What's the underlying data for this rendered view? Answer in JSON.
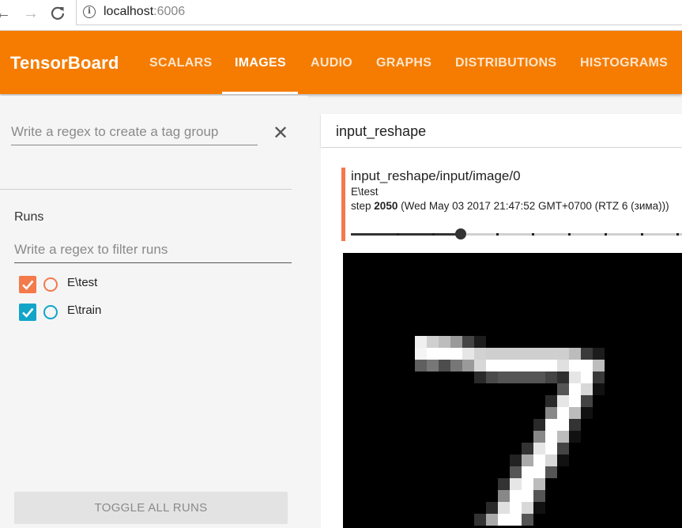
{
  "browser": {
    "url_host": "localhost",
    "url_port": ":6006"
  },
  "header": {
    "title": "TensorBoard",
    "tabs": [
      "SCALARS",
      "IMAGES",
      "AUDIO",
      "GRAPHS",
      "DISTRIBUTIONS",
      "HISTOGRAMS"
    ],
    "active_tab": "IMAGES",
    "accent_color": "#f57c00"
  },
  "sidebar": {
    "tag_regex_placeholder": "Write a regex to create a tag group",
    "runs_title": "Runs",
    "run_filter_placeholder": "Write a regex to filter runs",
    "runs": [
      {
        "label": "E\\test",
        "checked": true,
        "color": "#f4794b"
      },
      {
        "label": "E\\train",
        "checked": true,
        "color": "#12a5c8"
      }
    ],
    "toggle_all_label": "TOGGLE ALL RUNS"
  },
  "main": {
    "tag_group": "input_reshape",
    "image_card": {
      "tag": "input_reshape/input/image/0",
      "run": "E\\test",
      "step_prefix": "step",
      "step": "2050",
      "timestamp": "(Wed May 03 2017 21:47:52 GMT+0700 (RTZ 6 (зима)))",
      "slider_fraction": 0.33
    }
  }
}
